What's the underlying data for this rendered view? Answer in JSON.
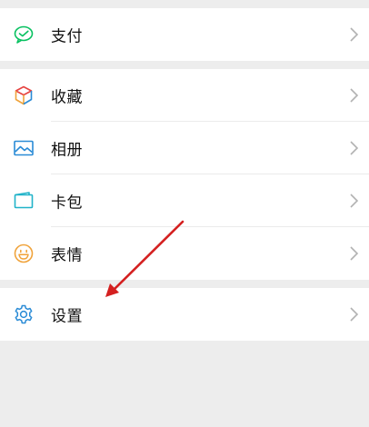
{
  "colors": {
    "accent": "#07c160",
    "blue": "#2a8bd6",
    "cyan": "#21b3c9",
    "orange": "#f0a33b",
    "annotation_arrow": "#d42020"
  },
  "menu": {
    "pay": {
      "label": "支付",
      "icon": "wechat-pay-icon"
    },
    "favorites": {
      "label": "收藏",
      "icon": "cube-icon"
    },
    "album": {
      "label": "相册",
      "icon": "image-icon"
    },
    "cards": {
      "label": "卡包",
      "icon": "card-wallet-icon"
    },
    "stickers": {
      "label": "表情",
      "icon": "smiley-icon"
    },
    "settings": {
      "label": "设置",
      "icon": "gear-icon"
    }
  },
  "chevron_icon": "chevron-right-icon",
  "annotation": {
    "type": "arrow",
    "points_to": "settings"
  }
}
